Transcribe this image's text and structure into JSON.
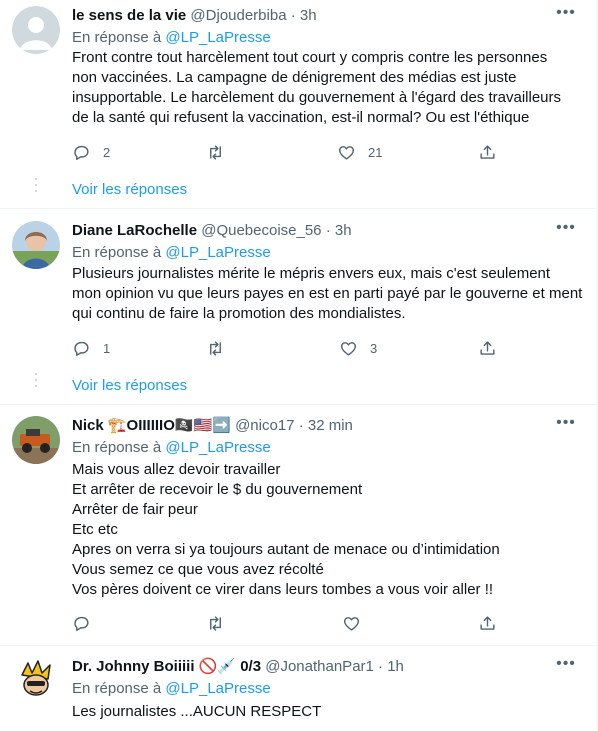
{
  "tweets": [
    {
      "name": "le sens de la vie",
      "name_emoji": "",
      "handle": "@Djouderbiba",
      "time": "· 3h",
      "reply_prefix": "En réponse à ",
      "reply_handle": "@LP_LaPresse",
      "lines": [
        "Front contre tout harcèlement tout court y compris contre les personnes",
        "non vaccinées. La campagne de dénigrement des médias est juste",
        "insupportable. Le harcèlement du gouvernement à l'égard des travailleurs",
        "de la santé qui refusent la vaccination, est-il normal? Ou est l'éthique"
      ],
      "reply_count": "2",
      "retweet_count": "",
      "like_count": "21",
      "show_replies": "Voir les réponses"
    },
    {
      "name": "Diane LaRochelle",
      "name_emoji": "",
      "handle": "@Quebecoise_56",
      "time": "· 3h",
      "reply_prefix": "En réponse à ",
      "reply_handle": "@LP_LaPresse",
      "lines": [
        "Plusieurs journalistes mérite le mépris envers eux, mais c'est seulement",
        "mon opinion vu que leurs payes en est en parti payé par le gouverne et ment",
        "qui continu de faire la promotion des mondialistes."
      ],
      "reply_count": "1",
      "retweet_count": "",
      "like_count": "3",
      "show_replies": "Voir les réponses"
    },
    {
      "name": "Nick",
      "name_emoji": "🏗️OIIIIIIO🏴‍☠️🇺🇸➡️",
      "handle": "@nico17",
      "time": "· 32 min",
      "reply_prefix": "En réponse à ",
      "reply_handle": "@LP_LaPresse",
      "lines": [
        "Mais vous allez devoir travailler",
        "Et arrêter de recevoir le $ du gouvernement",
        "Arrêter de fair peur",
        "Etc etc",
        "Apres on verra si ya toujours autant de menace ou d’intimidation",
        "Vous semez ce que vous avez récolté",
        "Vos pères doivent ce virer dans leurs tombes a vous voir aller !!"
      ],
      "reply_count": "",
      "retweet_count": "",
      "like_count": "",
      "show_replies": ""
    },
    {
      "name": "Dr. Johnny Boiiiii",
      "name_emoji": "🚫💉 0/3",
      "handle": "@JonathanPar1",
      "time": "· 1h",
      "reply_prefix": "En réponse à ",
      "reply_handle": "@LP_LaPresse",
      "lines": [
        "Les journalistes ...AUCUN RESPECT"
      ],
      "reply_count": "",
      "retweet_count": "",
      "like_count": "",
      "show_replies": ""
    }
  ],
  "icons": {
    "reply": "reply-icon",
    "retweet": "retweet-icon",
    "like": "heart-icon",
    "share": "share-icon",
    "more": "more-icon"
  },
  "colors": {
    "text": "#0f1419",
    "muted": "#536471",
    "link": "#1d9bf0",
    "divider": "#eff3f4"
  }
}
